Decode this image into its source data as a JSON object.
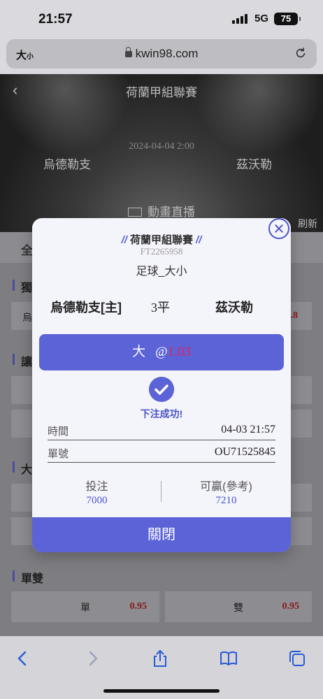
{
  "status_bar": {
    "time": "21:57",
    "network": "5G",
    "battery": "75"
  },
  "address_bar": {
    "text_size": "大",
    "text_size_small": "小",
    "url": "kwin98.com"
  },
  "hero": {
    "league": "荷蘭甲組聯賽",
    "datetime": "2024-04-04 2:00",
    "home_team": "烏德勒支",
    "away_team": "茲沃勒",
    "live_label": "動畫直播",
    "refresh_label": "刷新"
  },
  "page": {
    "tab_all": "全",
    "sections": [
      "獨",
      "讓",
      "大",
      "單雙"
    ],
    "row_label_partial": "烏",
    "row_odds_partial": ".8",
    "odd_even": [
      {
        "label": "單",
        "odds": "0.95"
      },
      {
        "label": "雙",
        "odds": "0.95"
      }
    ]
  },
  "modal": {
    "league": "荷蘭甲組聯賽",
    "league_deco": "//",
    "bet_code": "FT2265958",
    "bet_type": "足球_大小",
    "home": "烏德勒支[主]",
    "score": "3平",
    "away": "茲沃勒",
    "pick_label": "大",
    "pick_at": "@",
    "pick_odds": "1.03",
    "success": "下注成功!",
    "time_label": "時間",
    "time_value": "04-03 21:57",
    "order_label": "單號",
    "order_value": "OU71525845",
    "stake_label": "投注",
    "stake_value": "7000",
    "payout_label": "可贏(參考)",
    "payout_value": "7210",
    "close_label": "關閉"
  },
  "colors": {
    "accent": "#5b63d6",
    "odds_red": "#e0245e",
    "ios_blue": "#2a5bd7"
  },
  "icons": [
    "lock-icon",
    "reload-icon",
    "back-chevron-icon",
    "tv-icon",
    "close-circle-icon",
    "checkmark-icon",
    "browser-back-icon",
    "browser-forward-icon",
    "share-icon",
    "bookmarks-icon",
    "tabs-icon"
  ]
}
